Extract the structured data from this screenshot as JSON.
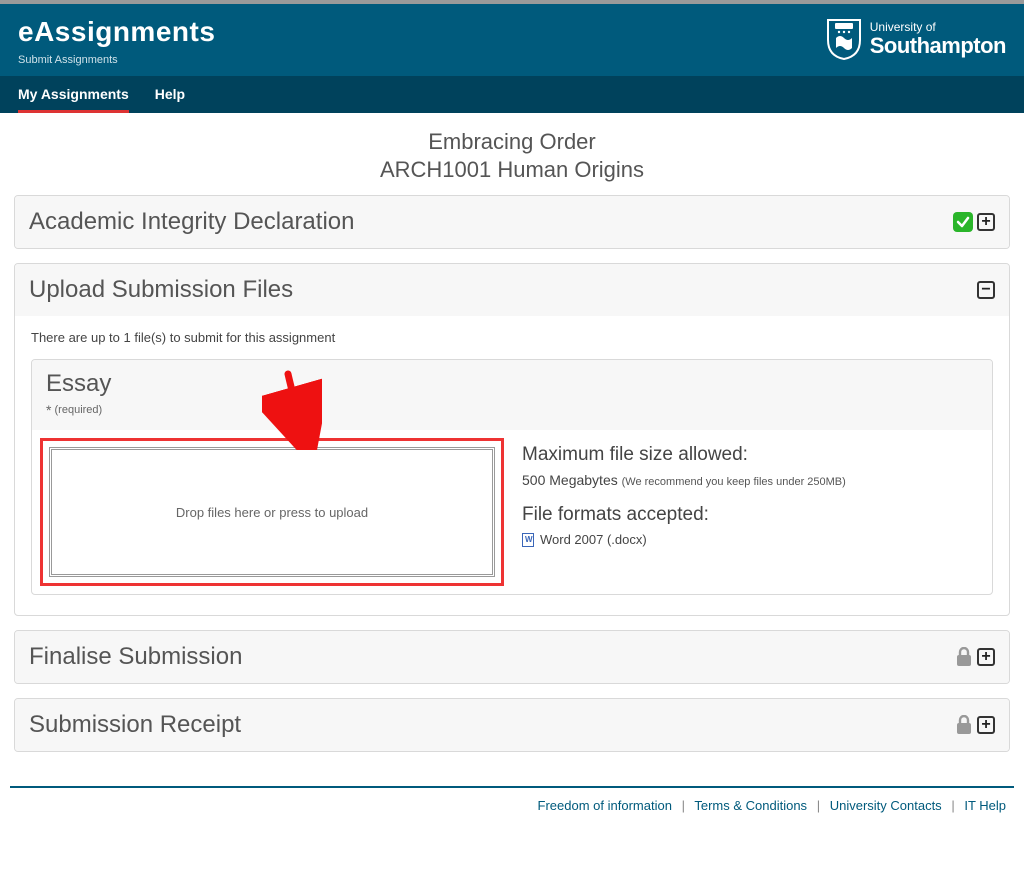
{
  "header": {
    "title": "eAssignments",
    "subtitle": "Submit Assignments",
    "org_line1": "University of",
    "org_line2": "Southampton"
  },
  "nav": {
    "my_assignments": "My Assignments",
    "help": "Help"
  },
  "page": {
    "title": "Embracing Order",
    "subtitle": "ARCH1001 Human Origins"
  },
  "panels": {
    "integrity": {
      "title": "Academic Integrity Declaration"
    },
    "upload": {
      "title": "Upload Submission Files",
      "hint": "There are up to 1 file(s) to submit for this assignment",
      "essay": {
        "title": "Essay",
        "required_label": "* (required)",
        "drop_text": "Drop files here or press to upload",
        "max_heading": "Maximum file size allowed:",
        "max_value": "500 Megabytes",
        "max_note": "(We recommend you keep files under 250MB)",
        "formats_heading": "File formats accepted:",
        "format1": "Word 2007 (.docx)"
      }
    },
    "finalise": {
      "title": "Finalise Submission"
    },
    "receipt": {
      "title": "Submission Receipt"
    }
  },
  "footer": {
    "foi": "Freedom of information",
    "terms": "Terms & Conditions",
    "contacts": "University Contacts",
    "ithelp": "IT Help"
  }
}
